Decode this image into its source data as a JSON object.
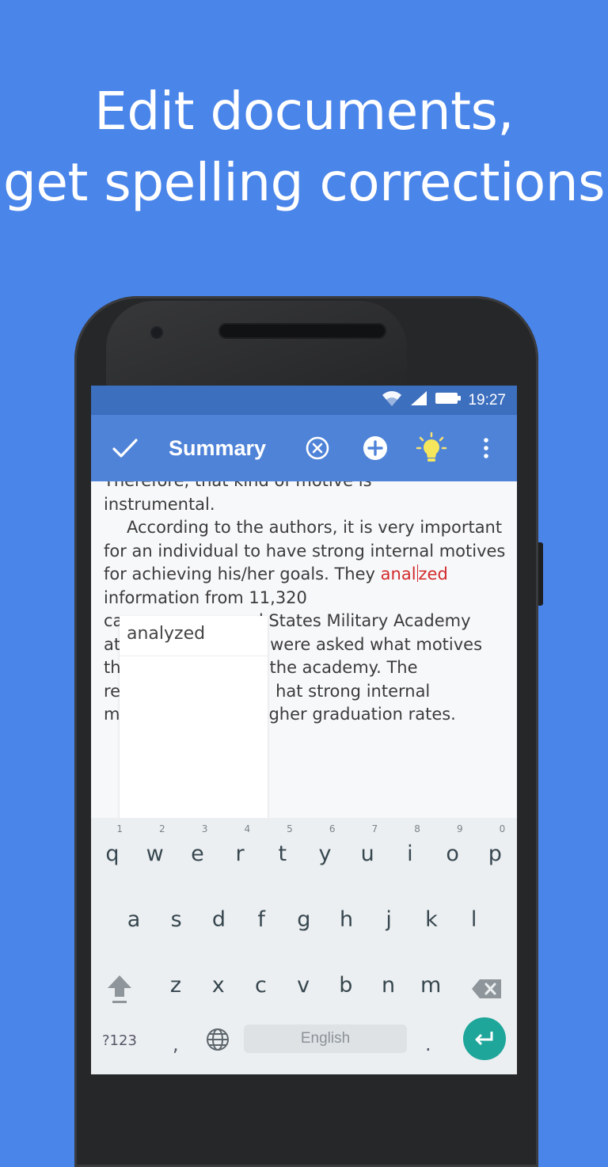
{
  "headline": {
    "line1": "Edit documents,",
    "line2": "get spelling corrections"
  },
  "statusbar": {
    "time": "19:27",
    "icons": [
      "wifi-icon",
      "signal-icon",
      "battery-icon"
    ]
  },
  "toolbar": {
    "title": "Summary",
    "icons": [
      "check-icon",
      "close-circle-icon",
      "add-circle-icon",
      "lightbulb-icon",
      "more-vert-icon"
    ]
  },
  "document": {
    "line0": "Therefore, that kind of motive is",
    "line1": "instrumental.",
    "para2_before": "According to the authors, it is very important for an individual to have strong internal motives for achieving his/her goals. They ",
    "misspelled_a": "anal",
    "misspelled_b": "zed",
    "para2_after": " information from 11,320",
    "line_c": "ca",
    "line_c_rest": "ed States Military Academy",
    "line_d": "at",
    "line_d_rest": "were asked what motives",
    "line_e": "th",
    "line_e_rest": "the academy. The",
    "line_f": "re",
    "line_f_rest": "hat strong internal",
    "line_g": "m",
    "line_g_rest": "gher graduation rates."
  },
  "suggestion": {
    "word": "analyzed"
  },
  "keyboard": {
    "row1": [
      "q",
      "w",
      "e",
      "r",
      "t",
      "y",
      "u",
      "i",
      "o",
      "p"
    ],
    "row1_hints": [
      "1",
      "2",
      "3",
      "4",
      "5",
      "6",
      "7",
      "8",
      "9",
      "0"
    ],
    "row2": [
      "a",
      "s",
      "d",
      "f",
      "g",
      "h",
      "j",
      "k",
      "l"
    ],
    "row3": [
      "z",
      "x",
      "c",
      "v",
      "b",
      "n",
      "m"
    ],
    "symbols_key": "?123",
    "comma_key": ",",
    "period_key": ".",
    "space_label": "English",
    "icons": [
      "shift-icon",
      "backspace-icon",
      "globe-icon",
      "enter-icon"
    ]
  },
  "colors": {
    "background": "#4a85ea",
    "toolbar": "#4f83d8",
    "statusbar": "#3d6fbf",
    "misspelled": "#d22b2b",
    "enter_key": "#1ea69a"
  }
}
